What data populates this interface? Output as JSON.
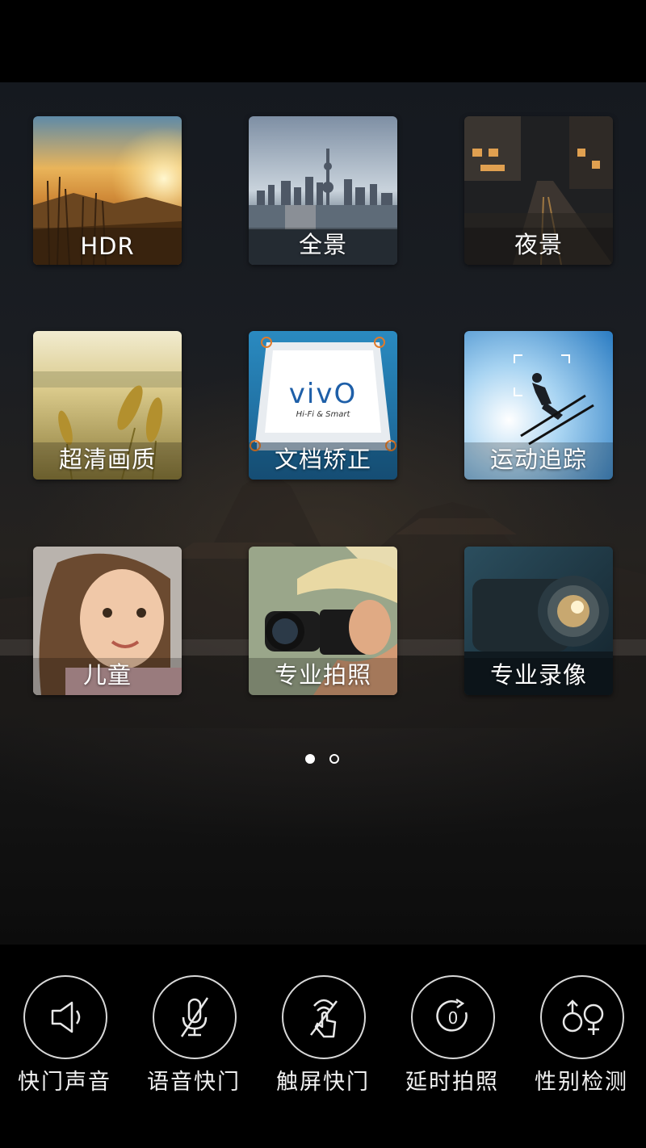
{
  "modes": [
    {
      "id": "hdr",
      "label": "HDR"
    },
    {
      "id": "panorama",
      "label": "全景"
    },
    {
      "id": "night",
      "label": "夜景"
    },
    {
      "id": "ultra-hd",
      "label": "超清画质"
    },
    {
      "id": "doc-correction",
      "label": "文档矫正"
    },
    {
      "id": "motion-tracking",
      "label": "运动追踪"
    },
    {
      "id": "children",
      "label": "儿童"
    },
    {
      "id": "pro-photo",
      "label": "专业拍照"
    },
    {
      "id": "pro-video",
      "label": "专业录像"
    }
  ],
  "doc_tile": {
    "brand": "vivO",
    "tagline": "Hi-Fi & Smart"
  },
  "pager": {
    "pages": 2,
    "current": 1
  },
  "tools": [
    {
      "id": "shutter-sound",
      "label": "快门声音",
      "icon": "speaker-icon"
    },
    {
      "id": "voice-shutter",
      "label": "语音快门",
      "icon": "mic-muted-icon"
    },
    {
      "id": "touch-shutter",
      "label": "触屏快门",
      "icon": "touch-off-icon"
    },
    {
      "id": "timer",
      "label": "延时拍照",
      "icon": "timer-icon"
    },
    {
      "id": "gender-detect",
      "label": "性别检测",
      "icon": "gender-icon"
    }
  ],
  "colors": {
    "background": "#000000",
    "accent": "#ffffff",
    "doc_corner": "#e07a2a"
  }
}
